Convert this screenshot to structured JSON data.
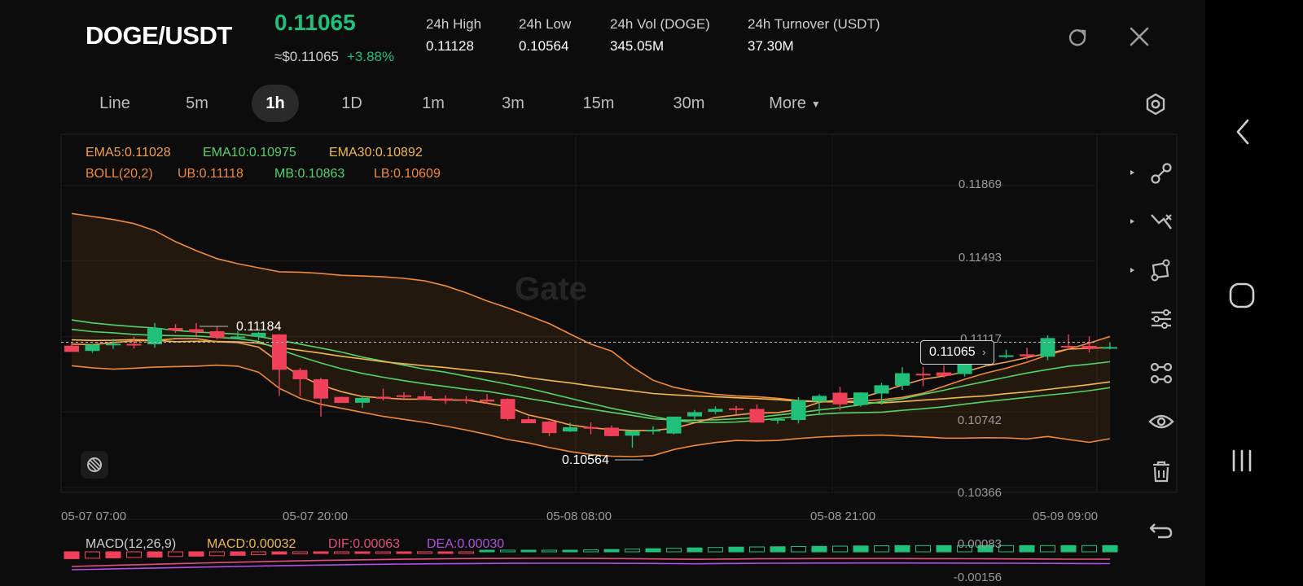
{
  "header": {
    "pair": "DOGE/USDT",
    "price": "0.11065",
    "approx": "≈$0.11065",
    "change": "+3.88%",
    "stats": [
      {
        "label": "24h   High",
        "value": "0.11128"
      },
      {
        "label": "24h   Low",
        "value": "0.10564"
      },
      {
        "label": "24h   Vol (DOGE)",
        "value": "345.05M"
      },
      {
        "label": "24h   Turnover (USDT)",
        "value": "37.30M"
      }
    ]
  },
  "tabs": [
    {
      "label": "Line",
      "active": false
    },
    {
      "label": "5m",
      "active": false
    },
    {
      "label": "1h",
      "active": true
    },
    {
      "label": "1D",
      "active": false
    },
    {
      "label": "1m",
      "active": false
    },
    {
      "label": "3m",
      "active": false
    },
    {
      "label": "15m",
      "active": false
    },
    {
      "label": "30m",
      "active": false
    },
    {
      "label": "More",
      "active": false
    }
  ],
  "indicators": {
    "ema5": "EMA5:0.11028",
    "ema10": "EMA10:0.10975",
    "ema30": "EMA30:0.10892",
    "boll": "BOLL(20,2)",
    "ub": "UB:0.11118",
    "mb": "MB:0.10863",
    "lb": "LB:0.10609"
  },
  "macd": {
    "name": "MACD(12,26,9)",
    "macd": "MACD:0.00032",
    "dif": "DIF:0.00063",
    "dea": "DEA:0.00030",
    "y_top": "0.00083",
    "y_bottom": "-0.00156"
  },
  "watermark": "Gate",
  "current_price_badge": "0.11065",
  "high_label": "0.11184",
  "low_label": "0.10564",
  "colors": {
    "up": "#20c07a",
    "down": "#f0405a",
    "ema5": "#f5a04a",
    "ema10": "#54d36a",
    "ema30": "#f0b850",
    "boll": "#f08a3a",
    "dif": "#e0507a",
    "dea": "#b050e0"
  },
  "icons": [
    "refresh-icon",
    "close-icon",
    "settings-icon",
    "draw-line-icon",
    "crossline-icon",
    "shape-icon",
    "adjust-icon",
    "template-icon",
    "eye-icon",
    "trash-icon",
    "undo-icon",
    "screenshot-icon",
    "back-nav-icon",
    "home-nav-icon",
    "recents-nav-icon"
  ],
  "chart_data": {
    "type": "candlestick",
    "ylim": [
      0.10366,
      0.11869
    ],
    "yticks": [
      "0.11869",
      "0.11493",
      "0.11117",
      "0.10742",
      "0.10366"
    ],
    "xticks": [
      "05-07 07:00",
      "05-07 20:00",
      "05-08 08:00",
      "05-08 21:00",
      "05-09 09:00"
    ],
    "candles": [
      [
        0.11072,
        0.11091,
        0.11041,
        0.11041
      ],
      [
        0.11046,
        0.11082,
        0.11037,
        0.11077
      ],
      [
        0.11079,
        0.11106,
        0.11056,
        0.11082
      ],
      [
        0.11081,
        0.11117,
        0.11058,
        0.11079
      ],
      [
        0.11079,
        0.11186,
        0.11061,
        0.1116
      ],
      [
        0.1116,
        0.11179,
        0.11136,
        0.11148
      ],
      [
        0.11154,
        0.11184,
        0.11121,
        0.1114
      ],
      [
        0.11144,
        0.11169,
        0.11103,
        0.11112
      ],
      [
        0.11118,
        0.11144,
        0.11107,
        0.11118
      ],
      [
        0.11117,
        0.11141,
        0.11101,
        0.11136
      ],
      [
        0.11128,
        0.11129,
        0.10822,
        0.10952
      ],
      [
        0.10951,
        0.10961,
        0.10821,
        0.10905
      ],
      [
        0.10905,
        0.10912,
        0.10719,
        0.10809
      ],
      [
        0.10817,
        0.10818,
        0.10787,
        0.10787
      ],
      [
        0.10788,
        0.1082,
        0.10762,
        0.10812
      ],
      [
        0.10818,
        0.10858,
        0.10799,
        0.10808
      ],
      [
        0.10825,
        0.1084,
        0.1081,
        0.1082
      ],
      [
        0.1082,
        0.10846,
        0.10805,
        0.10804
      ],
      [
        0.10809,
        0.10825,
        0.10782,
        0.10798
      ],
      [
        0.10805,
        0.10821,
        0.10783,
        0.10804
      ],
      [
        0.10804,
        0.10831,
        0.10785,
        0.10794
      ],
      [
        0.10807,
        0.1081,
        0.107,
        0.10707
      ],
      [
        0.10706,
        0.10721,
        0.10691,
        0.10686
      ],
      [
        0.10694,
        0.10698,
        0.10622,
        0.10637
      ],
      [
        0.10645,
        0.10688,
        0.10643,
        0.10666
      ],
      [
        0.10667,
        0.1069,
        0.10631,
        0.10663
      ],
      [
        0.10664,
        0.10675,
        0.10621,
        0.10622
      ],
      [
        0.10624,
        0.10648,
        0.10564,
        0.10648
      ],
      [
        0.1065,
        0.10671,
        0.1063,
        0.10653
      ],
      [
        0.10635,
        0.10712,
        0.10631,
        0.10719
      ],
      [
        0.1072,
        0.10752,
        0.10703,
        0.10741
      ],
      [
        0.10743,
        0.1077,
        0.10732,
        0.10757
      ],
      [
        0.1076,
        0.10772,
        0.1073,
        0.10758
      ],
      [
        0.10757,
        0.1078,
        0.1072,
        0.10689
      ],
      [
        0.10704,
        0.1071,
        0.10684,
        0.10707
      ],
      [
        0.10702,
        0.10816,
        0.10685,
        0.108
      ],
      [
        0.10794,
        0.1083,
        0.10735,
        0.10822
      ],
      [
        0.10838,
        0.10867,
        0.1075,
        0.1078
      ],
      [
        0.10777,
        0.1084,
        0.10769,
        0.10839
      ],
      [
        0.10834,
        0.10887,
        0.10779,
        0.10875
      ],
      [
        0.10873,
        0.10965,
        0.10852,
        0.10935
      ],
      [
        0.10932,
        0.10966,
        0.10871,
        0.10927
      ],
      [
        0.10939,
        0.10973,
        0.10913,
        0.10922
      ],
      [
        0.10931,
        0.11004,
        0.10918,
        0.10998
      ],
      [
        0.11001,
        0.1105,
        0.10969,
        0.11019
      ],
      [
        0.1102,
        0.11052,
        0.11009,
        0.11024
      ],
      [
        0.11029,
        0.11062,
        0.11004,
        0.11019
      ],
      [
        0.11017,
        0.11124,
        0.11,
        0.1111
      ],
      [
        0.11071,
        0.11128,
        0.11052,
        0.11068
      ],
      [
        0.11071,
        0.11118,
        0.11038,
        0.11058
      ],
      [
        0.11062,
        0.11089,
        0.11054,
        0.11065
      ]
    ],
    "ema5": [
      0.1108,
      0.11077,
      0.11088,
      0.11096,
      0.11098,
      0.11107,
      0.11107,
      0.11091,
      0.11087,
      0.11065,
      0.10989,
      0.10921,
      0.10876,
      0.10843,
      0.10819,
      0.10812,
      0.10806,
      0.10806,
      0.10802,
      0.10801,
      0.10786,
      0.10767,
      0.10727,
      0.10705,
      0.10678,
      0.10663,
      0.10655,
      0.1065,
      0.1065,
      0.10661,
      0.10688,
      0.10715,
      0.10727,
      0.10737,
      0.10739,
      0.10755,
      0.1079,
      0.10803,
      0.10813,
      0.10843,
      0.10876,
      0.10905,
      0.10921,
      0.10941,
      0.10971,
      0.1099,
      0.11013,
      0.11034,
      0.11055,
      0.11059,
      0.11063
    ],
    "ema10": [
      0.11153,
      0.11142,
      0.11136,
      0.11128,
      0.11124,
      0.11122,
      0.1112,
      0.11114,
      0.11107,
      0.11093,
      0.11053,
      0.11018,
      0.10986,
      0.10957,
      0.10934,
      0.10915,
      0.10898,
      0.10882,
      0.10869,
      0.10855,
      0.10845,
      0.10828,
      0.10809,
      0.10792,
      0.10772,
      0.10756,
      0.1074,
      0.10725,
      0.10708,
      0.10702,
      0.10701,
      0.10703,
      0.10708,
      0.10715,
      0.10727,
      0.10738,
      0.10752,
      0.10763,
      0.10778,
      0.10793,
      0.10808,
      0.1083,
      0.1085,
      0.10873,
      0.10894,
      0.10915,
      0.10936,
      0.10953,
      0.1097,
      0.1098,
      0.10992
    ],
    "ema30": [
      0.11101,
      0.11098,
      0.11099,
      0.11102,
      0.11099,
      0.11092,
      0.11094,
      0.11093,
      0.11091,
      0.11085,
      0.11063,
      0.11049,
      0.11035,
      0.11019,
      0.11006,
      0.10992,
      0.10982,
      0.10972,
      0.10963,
      0.10952,
      0.10942,
      0.1093,
      0.10913,
      0.10899,
      0.10887,
      0.10872,
      0.10859,
      0.10847,
      0.10834,
      0.10827,
      0.10822,
      0.10818,
      0.10813,
      0.10809,
      0.10803,
      0.10796,
      0.10793,
      0.10792,
      0.10789,
      0.10787,
      0.10794,
      0.10801,
      0.10808,
      0.10816,
      0.10822,
      0.10833,
      0.10842,
      0.10854,
      0.10866,
      0.10878,
      0.10892
    ],
    "boll_ub": [
      0.1173,
      0.11715,
      0.117,
      0.1168,
      0.11645,
      0.1159,
      0.11545,
      0.11505,
      0.1148,
      0.1146,
      0.1144,
      0.11438,
      0.11432,
      0.11422,
      0.11419,
      0.11415,
      0.11407,
      0.11395,
      0.1137,
      0.11335,
      0.11295,
      0.1126,
      0.11222,
      0.11182,
      0.1113,
      0.1108,
      0.11045,
      0.10965,
      0.109,
      0.10865,
      0.10845,
      0.1083,
      0.10822,
      0.10818,
      0.1081,
      0.10799,
      0.10795,
      0.10795,
      0.10797,
      0.10803,
      0.10815,
      0.10835,
      0.1087,
      0.10905,
      0.10935,
      0.1096,
      0.1099,
      0.11025,
      0.11055,
      0.11085,
      0.11118
    ],
    "boll_mb": [
      0.112,
      0.11185,
      0.11175,
      0.11167,
      0.1116,
      0.11148,
      0.1114,
      0.11135,
      0.1113,
      0.11118,
      0.111,
      0.1108,
      0.1106,
      0.1104,
      0.11015,
      0.10995,
      0.10975,
      0.10955,
      0.1094,
      0.1092,
      0.109,
      0.1088,
      0.1086,
      0.10835,
      0.1081,
      0.10785,
      0.1076,
      0.1074,
      0.1072,
      0.107,
      0.1069,
      0.1069,
      0.10692,
      0.107,
      0.1071,
      0.1072,
      0.10731,
      0.10737,
      0.10739,
      0.10741,
      0.1075,
      0.10758,
      0.10768,
      0.10781,
      0.10793,
      0.10804,
      0.10815,
      0.10826,
      0.10836,
      0.10848,
      0.10863
    ],
    "boll_lb": [
      0.10972,
      0.10962,
      0.10955,
      0.1096,
      0.10965,
      0.10968,
      0.1097,
      0.10975,
      0.1097,
      0.1094,
      0.1086,
      0.1081,
      0.1078,
      0.1076,
      0.1074,
      0.1072,
      0.10705,
      0.1069,
      0.10672,
      0.10652,
      0.1063,
      0.10605,
      0.10588,
      0.10565,
      0.10545,
      0.1053,
      0.10522,
      0.1052,
      0.10525,
      0.10555,
      0.10575,
      0.1059,
      0.106,
      0.10598,
      0.106,
      0.1061,
      0.10617,
      0.10622,
      0.10625,
      0.10627,
      0.10622,
      0.10618,
      0.10612,
      0.10612,
      0.10614,
      0.10613,
      0.10608,
      0.1062,
      0.10605,
      0.10591,
      0.10609
    ],
    "macd_hist": [
      -0.00035,
      -0.00033,
      -0.00031,
      -0.00029,
      -0.00027,
      -0.00024,
      -0.00022,
      -0.0002,
      -0.00018,
      -0.00015,
      -0.00012,
      -0.0001,
      -8e-05,
      -8e-05,
      -6e-05,
      -5e-05,
      -4e-05,
      -3e-05,
      -2e-05,
      -1e-05,
      1e-05,
      3e-05,
      4e-05,
      6e-05,
      8e-05,
      0.0001,
      0.00012,
      0.00014,
      0.00016,
      0.00018,
      0.0002,
      0.00022,
      0.00024,
      0.00025,
      0.00026,
      0.00027,
      0.00028,
      0.00029,
      0.0003,
      0.00031,
      0.00032,
      0.00032,
      0.00032,
      0.00032,
      0.00032,
      0.00032,
      0.00032,
      0.00032,
      0.00032,
      0.00032,
      0.00032
    ]
  }
}
